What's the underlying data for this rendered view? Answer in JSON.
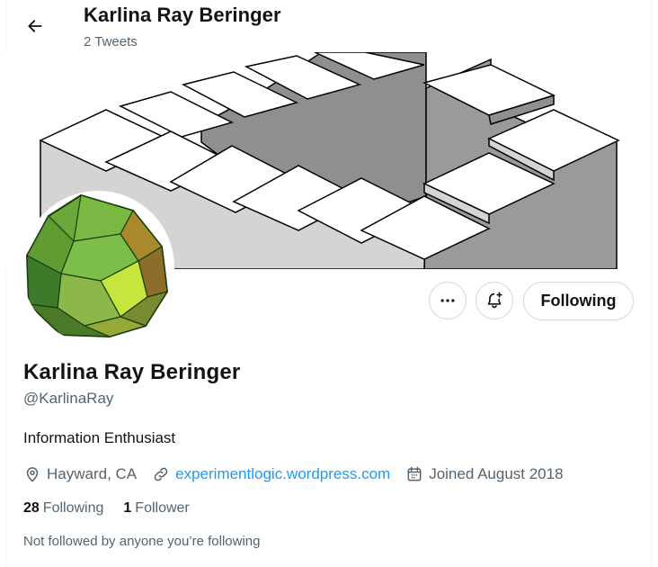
{
  "header": {
    "title": "Karlina Ray Beringer",
    "subtitle": "2 Tweets"
  },
  "actions": {
    "following_label": "Following"
  },
  "profile": {
    "display_name": "Karlina Ray Beringer",
    "handle": "@KarlinaRay",
    "bio": "Information Enthusiast",
    "location": "Hayward, CA",
    "website": "experimentlogic.wordpress.com",
    "joined": "Joined August 2018"
  },
  "stats": {
    "following_count": "28",
    "following_label": "Following",
    "followers_count": "1",
    "followers_label": "Follower"
  },
  "social_context": "Not followed by anyone you’re following",
  "icons": {
    "back": "arrow-left-icon",
    "more": "more-horizontal-icon",
    "notify": "bell-plus-icon",
    "location": "location-pin-icon",
    "link": "link-icon",
    "calendar": "calendar-icon"
  },
  "colors": {
    "link": "#1d9bf0",
    "secondary_text": "#536471",
    "primary_text": "#0f1419",
    "border": "#cfd9de"
  }
}
